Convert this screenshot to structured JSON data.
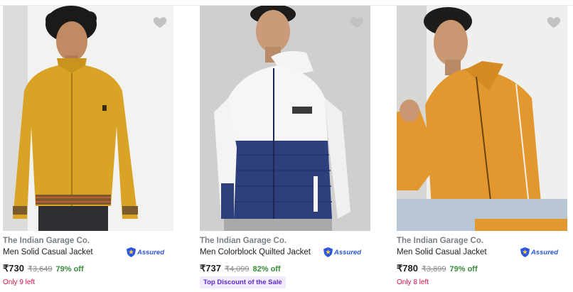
{
  "products": [
    {
      "brand": "The Indian Garage Co.",
      "title": "Men Solid Casual Jacket",
      "assured_label": "Assured",
      "price": "₹730",
      "mrp": "₹3,649",
      "discount": "79% off",
      "stock_note": "Only 9 left",
      "image_desc": "man in mustard yellow zip jacket",
      "jacket_color": "#d9a326",
      "wishlisted": false
    },
    {
      "brand": "The Indian Garage Co.",
      "title": "Men Colorblock Quilted Jacket",
      "assured_label": "Assured",
      "price": "₹737",
      "mrp": "₹4,099",
      "discount": "82% off",
      "badge": "Top Discount of the Sale",
      "image_desc": "man in white and navy quilted hooded jacket",
      "jacket_color": "#2e3f7e",
      "wishlisted": false
    },
    {
      "brand": "The Indian Garage Co.",
      "title": "Men Solid Casual Jacket",
      "assured_label": "Assured",
      "price": "₹780",
      "mrp": "₹3,899",
      "discount": "79% off",
      "stock_note": "Only 8 left",
      "image_desc": "man in orange zip jacket",
      "jacket_color": "#e2982f",
      "wishlisted": false
    }
  ],
  "colors": {
    "price_discount": "#388e3c",
    "stock_note": "#d5124a",
    "badge_text": "#5a2bd4",
    "badge_bg": "#f1eafe",
    "assured": "#2a55e5",
    "heart": "#c2c2c2"
  }
}
